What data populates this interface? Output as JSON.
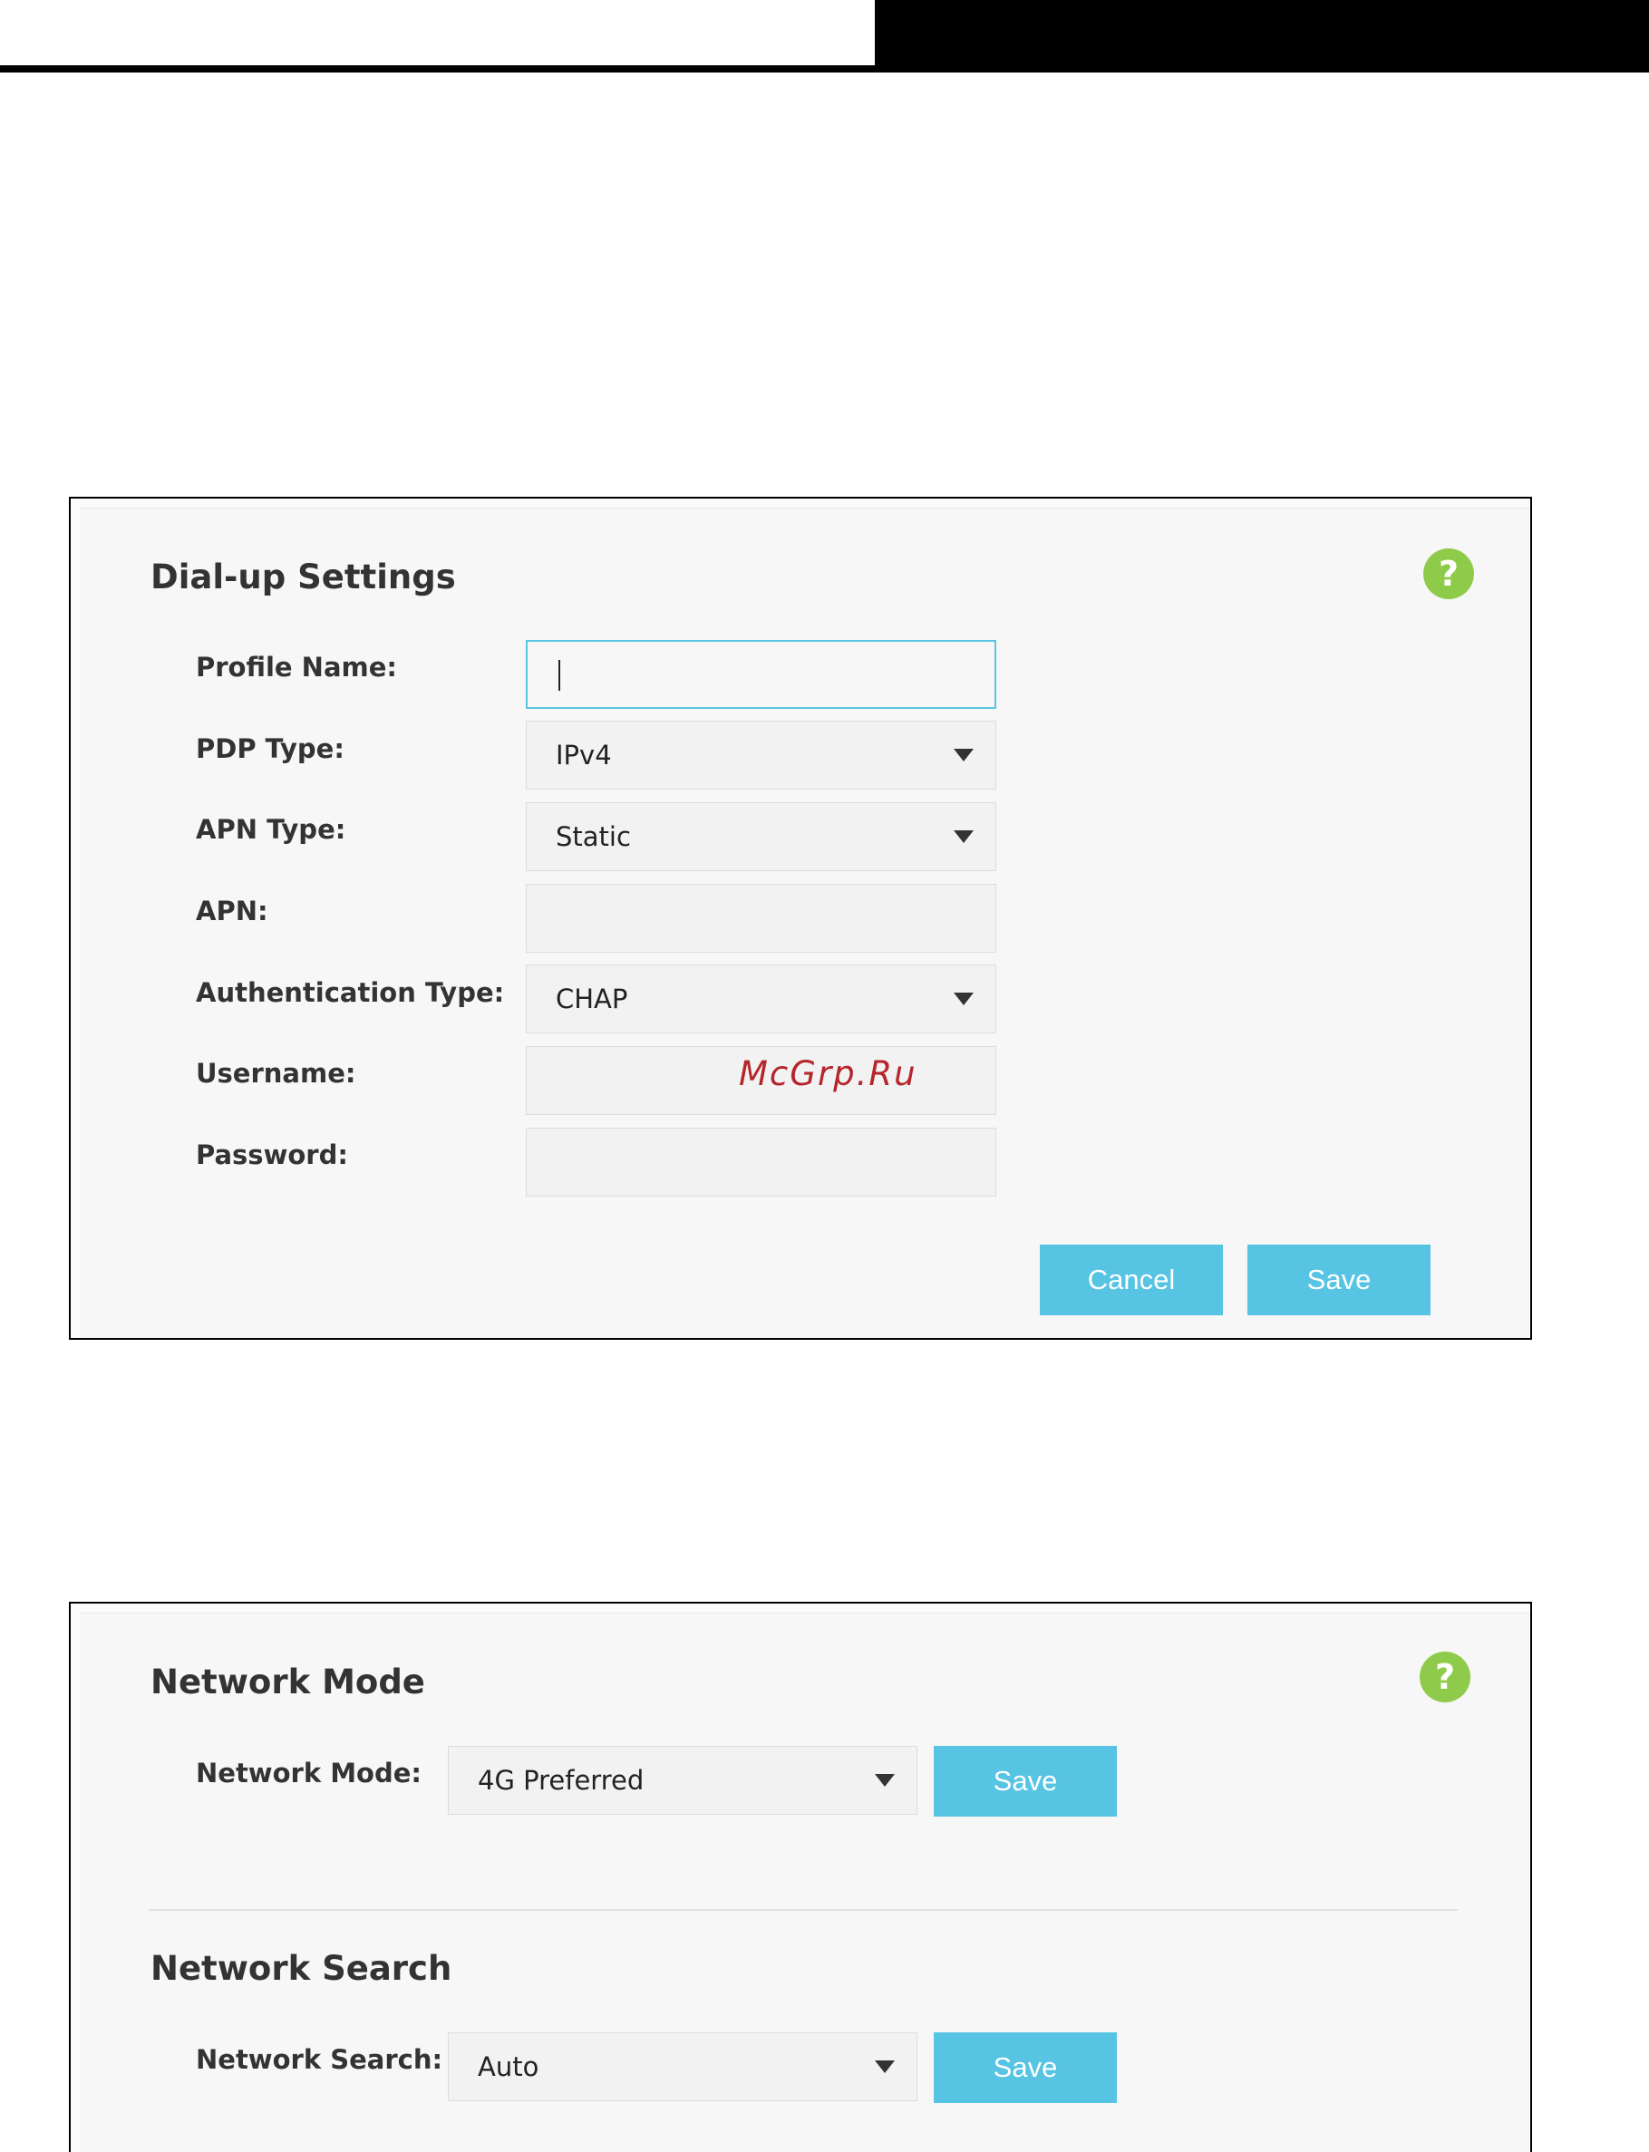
{
  "dialup": {
    "title": "Dial-up Settings",
    "help": "?",
    "fields": {
      "profile_name": {
        "label": "Profile Name:",
        "value": ""
      },
      "pdp_type": {
        "label": "PDP Type:",
        "value": "IPv4"
      },
      "apn_type": {
        "label": "APN Type:",
        "value": "Static"
      },
      "apn": {
        "label": "APN:",
        "value": ""
      },
      "auth_type": {
        "label": "Authentication Type:",
        "value": "CHAP"
      },
      "username": {
        "label": "Username:",
        "value": ""
      },
      "password": {
        "label": "Password:",
        "value": ""
      }
    },
    "cancel_label": "Cancel",
    "save_label": "Save"
  },
  "network_mode": {
    "title": "Network Mode",
    "help": "?",
    "label": "Network Mode:",
    "value": "4G Preferred",
    "save_label": "Save"
  },
  "network_search": {
    "title": "Network Search",
    "label": "Network Search:",
    "value": "Auto",
    "save_label": "Save"
  },
  "watermark": "McGrp.Ru",
  "colors": {
    "accent": "#56c4e2",
    "help_icon": "#8fcb4a",
    "focus_border": "#5bc6df"
  },
  "icons": {
    "help": "help-icon",
    "dropdown": "chevron-down-icon"
  }
}
